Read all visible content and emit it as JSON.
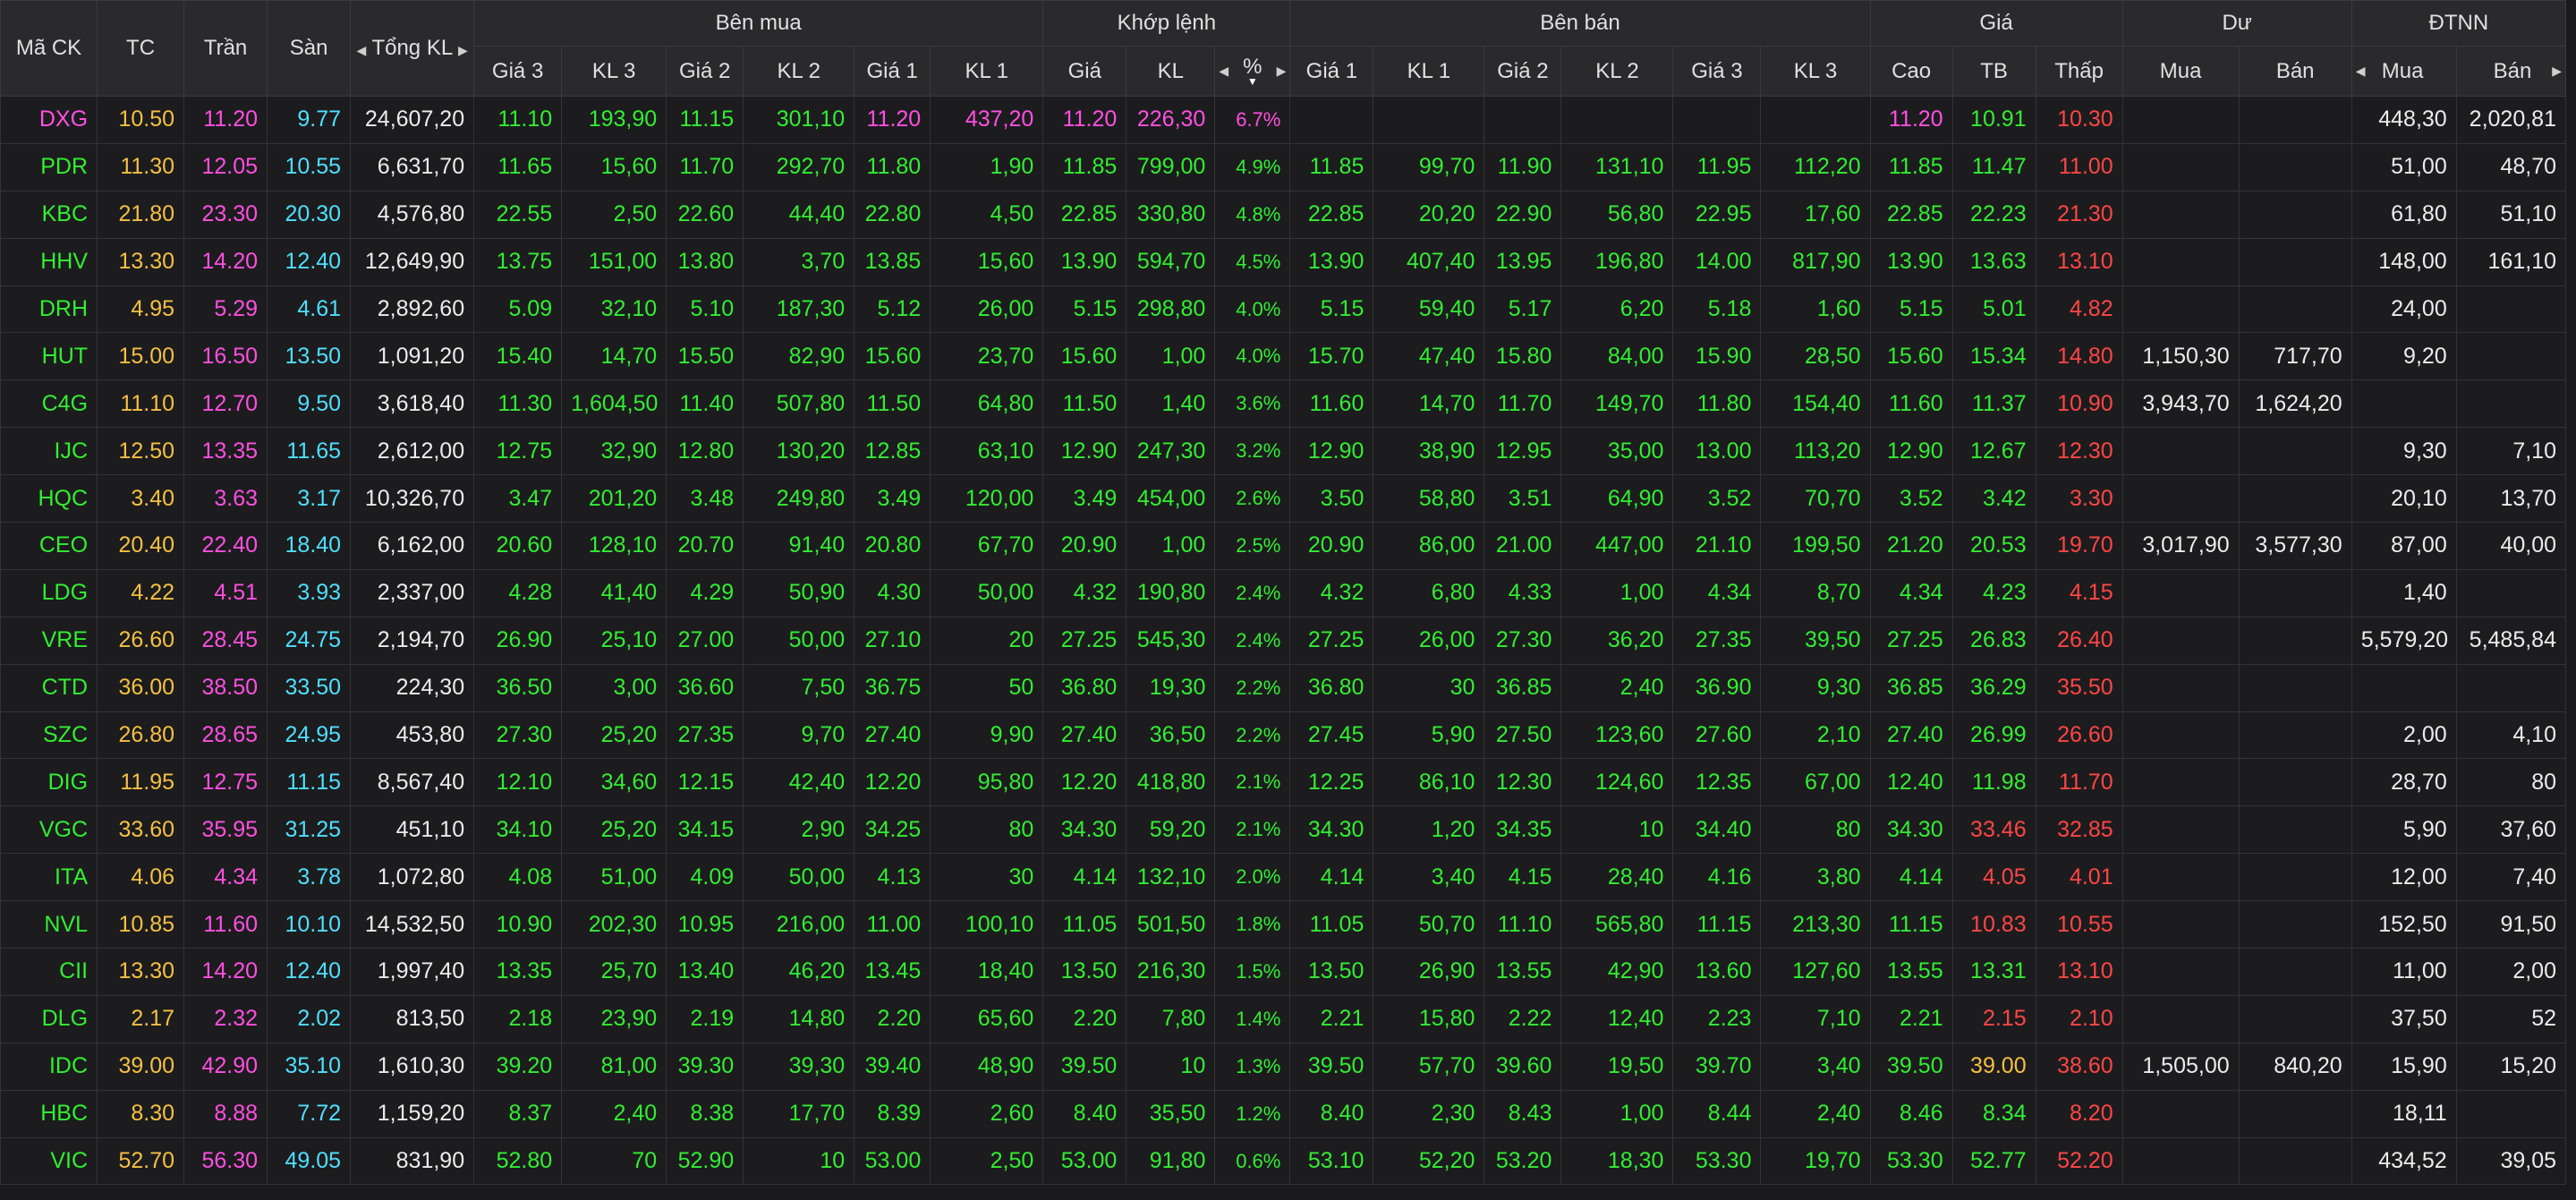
{
  "colors": {
    "ref": "#f5c042",
    "ceiling": "#ff4fe2",
    "floor": "#4fdfff",
    "up": "#32ee32",
    "down": "#ff4545",
    "neutral": "#ececec"
  },
  "header": {
    "symbol": "Mã CK",
    "ref": "TC",
    "ceiling": "Trần",
    "floor": "Sàn",
    "total_volume": "Tổng KL",
    "groups": {
      "buy": "Bên mua",
      "match": "Khớp lệnh",
      "sell": "Bên bán",
      "price": "Giá",
      "remaining": "Dư",
      "foreign": "ĐTNN"
    },
    "sub": {
      "buy": [
        "Giá 3",
        "KL 3",
        "Giá 2",
        "KL 2",
        "Giá 1",
        "KL 1"
      ],
      "match": [
        "Giá",
        "KL",
        "%"
      ],
      "sell": [
        "Giá 1",
        "KL 1",
        "Giá 2",
        "KL 2",
        "Giá 3",
        "KL 3"
      ],
      "price": [
        "Cao",
        "TB",
        "Thấp"
      ],
      "remaining": [
        "Mua",
        "Bán"
      ],
      "foreign": [
        "Mua",
        "Bán"
      ]
    }
  },
  "rows": [
    {
      "sym": "DXG",
      "tc": "10.50",
      "tran": "11.20",
      "san": "9.77",
      "tkl": "24,607,20",
      "bg3": "11.10",
      "bk3": "193,90",
      "bg2": "11.15",
      "bk2": "301,10",
      "bg1": "11.20",
      "bk1": "437,20",
      "mg": "11.20",
      "mk": "226,30",
      "mp": "6.7%",
      "sg1": "",
      "sk1": "",
      "sg2": "",
      "sk2": "",
      "sg3": "",
      "sk3": "",
      "cao": "11.20",
      "tb": "10.91",
      "thap": "10.30",
      "dm": "",
      "db": "",
      "fm": "448,30",
      "fb": "2,020,81"
    },
    {
      "sym": "PDR",
      "tc": "11.30",
      "tran": "12.05",
      "san": "10.55",
      "tkl": "6,631,70",
      "bg3": "11.65",
      "bk3": "15,60",
      "bg2": "11.70",
      "bk2": "292,70",
      "bg1": "11.80",
      "bk1": "1,90",
      "mg": "11.85",
      "mk": "799,00",
      "mp": "4.9%",
      "sg1": "11.85",
      "sk1": "99,70",
      "sg2": "11.90",
      "sk2": "131,10",
      "sg3": "11.95",
      "sk3": "112,20",
      "cao": "11.85",
      "tb": "11.47",
      "thap": "11.00",
      "dm": "",
      "db": "",
      "fm": "51,00",
      "fb": "48,70"
    },
    {
      "sym": "KBC",
      "tc": "21.80",
      "tran": "23.30",
      "san": "20.30",
      "tkl": "4,576,80",
      "bg3": "22.55",
      "bk3": "2,50",
      "bg2": "22.60",
      "bk2": "44,40",
      "bg1": "22.80",
      "bk1": "4,50",
      "mg": "22.85",
      "mk": "330,80",
      "mp": "4.8%",
      "sg1": "22.85",
      "sk1": "20,20",
      "sg2": "22.90",
      "sk2": "56,80",
      "sg3": "22.95",
      "sk3": "17,60",
      "cao": "22.85",
      "tb": "22.23",
      "thap": "21.30",
      "dm": "",
      "db": "",
      "fm": "61,80",
      "fb": "51,10"
    },
    {
      "sym": "HHV",
      "tc": "13.30",
      "tran": "14.20",
      "san": "12.40",
      "tkl": "12,649,90",
      "bg3": "13.75",
      "bk3": "151,00",
      "bg2": "13.80",
      "bk2": "3,70",
      "bg1": "13.85",
      "bk1": "15,60",
      "mg": "13.90",
      "mk": "594,70",
      "mp": "4.5%",
      "sg1": "13.90",
      "sk1": "407,40",
      "sg2": "13.95",
      "sk2": "196,80",
      "sg3": "14.00",
      "sk3": "817,90",
      "cao": "13.90",
      "tb": "13.63",
      "thap": "13.10",
      "dm": "",
      "db": "",
      "fm": "148,00",
      "fb": "161,10"
    },
    {
      "sym": "DRH",
      "tc": "4.95",
      "tran": "5.29",
      "san": "4.61",
      "tkl": "2,892,60",
      "bg3": "5.09",
      "bk3": "32,10",
      "bg2": "5.10",
      "bk2": "187,30",
      "bg1": "5.12",
      "bk1": "26,00",
      "mg": "5.15",
      "mk": "298,80",
      "mp": "4.0%",
      "sg1": "5.15",
      "sk1": "59,40",
      "sg2": "5.17",
      "sk2": "6,20",
      "sg3": "5.18",
      "sk3": "1,60",
      "cao": "5.15",
      "tb": "5.01",
      "thap": "4.82",
      "dm": "",
      "db": "",
      "fm": "24,00",
      "fb": ""
    },
    {
      "sym": "HUT",
      "tc": "15.00",
      "tran": "16.50",
      "san": "13.50",
      "tkl": "1,091,20",
      "bg3": "15.40",
      "bk3": "14,70",
      "bg2": "15.50",
      "bk2": "82,90",
      "bg1": "15.60",
      "bk1": "23,70",
      "mg": "15.60",
      "mk": "1,00",
      "mp": "4.0%",
      "sg1": "15.70",
      "sk1": "47,40",
      "sg2": "15.80",
      "sk2": "84,00",
      "sg3": "15.90",
      "sk3": "28,50",
      "cao": "15.60",
      "tb": "15.34",
      "thap": "14.80",
      "dm": "1,150,30",
      "db": "717,70",
      "fm": "9,20",
      "fb": ""
    },
    {
      "sym": "C4G",
      "tc": "11.10",
      "tran": "12.70",
      "san": "9.50",
      "tkl": "3,618,40",
      "bg3": "11.30",
      "bk3": "1,604,50",
      "bg2": "11.40",
      "bk2": "507,80",
      "bg1": "11.50",
      "bk1": "64,80",
      "mg": "11.50",
      "mk": "1,40",
      "mp": "3.6%",
      "sg1": "11.60",
      "sk1": "14,70",
      "sg2": "11.70",
      "sk2": "149,70",
      "sg3": "11.80",
      "sk3": "154,40",
      "cao": "11.60",
      "tb": "11.37",
      "thap": "10.90",
      "dm": "3,943,70",
      "db": "1,624,20",
      "fm": "",
      "fb": ""
    },
    {
      "sym": "IJC",
      "tc": "12.50",
      "tran": "13.35",
      "san": "11.65",
      "tkl": "2,612,00",
      "bg3": "12.75",
      "bk3": "32,90",
      "bg2": "12.80",
      "bk2": "130,20",
      "bg1": "12.85",
      "bk1": "63,10",
      "mg": "12.90",
      "mk": "247,30",
      "mp": "3.2%",
      "sg1": "12.90",
      "sk1": "38,90",
      "sg2": "12.95",
      "sk2": "35,00",
      "sg3": "13.00",
      "sk3": "113,20",
      "cao": "12.90",
      "tb": "12.67",
      "thap": "12.30",
      "dm": "",
      "db": "",
      "fm": "9,30",
      "fb": "7,10"
    },
    {
      "sym": "HQC",
      "tc": "3.40",
      "tran": "3.63",
      "san": "3.17",
      "tkl": "10,326,70",
      "bg3": "3.47",
      "bk3": "201,20",
      "bg2": "3.48",
      "bk2": "249,80",
      "bg1": "3.49",
      "bk1": "120,00",
      "mg": "3.49",
      "mk": "454,00",
      "mp": "2.6%",
      "sg1": "3.50",
      "sk1": "58,80",
      "sg2": "3.51",
      "sk2": "64,90",
      "sg3": "3.52",
      "sk3": "70,70",
      "cao": "3.52",
      "tb": "3.42",
      "thap": "3.30",
      "dm": "",
      "db": "",
      "fm": "20,10",
      "fb": "13,70"
    },
    {
      "sym": "CEO",
      "tc": "20.40",
      "tran": "22.40",
      "san": "18.40",
      "tkl": "6,162,00",
      "bg3": "20.60",
      "bk3": "128,10",
      "bg2": "20.70",
      "bk2": "91,40",
      "bg1": "20.80",
      "bk1": "67,70",
      "mg": "20.90",
      "mk": "1,00",
      "mp": "2.5%",
      "sg1": "20.90",
      "sk1": "86,00",
      "sg2": "21.00",
      "sk2": "447,00",
      "sg3": "21.10",
      "sk3": "199,50",
      "cao": "21.20",
      "tb": "20.53",
      "thap": "19.70",
      "dm": "3,017,90",
      "db": "3,577,30",
      "fm": "87,00",
      "fb": "40,00"
    },
    {
      "sym": "LDG",
      "tc": "4.22",
      "tran": "4.51",
      "san": "3.93",
      "tkl": "2,337,00",
      "bg3": "4.28",
      "bk3": "41,40",
      "bg2": "4.29",
      "bk2": "50,90",
      "bg1": "4.30",
      "bk1": "50,00",
      "mg": "4.32",
      "mk": "190,80",
      "mp": "2.4%",
      "sg1": "4.32",
      "sk1": "6,80",
      "sg2": "4.33",
      "sk2": "1,00",
      "sg3": "4.34",
      "sk3": "8,70",
      "cao": "4.34",
      "tb": "4.23",
      "thap": "4.15",
      "dm": "",
      "db": "",
      "fm": "1,40",
      "fb": ""
    },
    {
      "sym": "VRE",
      "tc": "26.60",
      "tran": "28.45",
      "san": "24.75",
      "tkl": "2,194,70",
      "bg3": "26.90",
      "bk3": "25,10",
      "bg2": "27.00",
      "bk2": "50,00",
      "bg1": "27.10",
      "bk1": "20",
      "mg": "27.25",
      "mk": "545,30",
      "mp": "2.4%",
      "sg1": "27.25",
      "sk1": "26,00",
      "sg2": "27.30",
      "sk2": "36,20",
      "sg3": "27.35",
      "sk3": "39,50",
      "cao": "27.25",
      "tb": "26.83",
      "thap": "26.40",
      "dm": "",
      "db": "",
      "fm": "5,579,20",
      "fb": "5,485,84"
    },
    {
      "sym": "CTD",
      "tc": "36.00",
      "tran": "38.50",
      "san": "33.50",
      "tkl": "224,30",
      "bg3": "36.50",
      "bk3": "3,00",
      "bg2": "36.60",
      "bk2": "7,50",
      "bg1": "36.75",
      "bk1": "50",
      "mg": "36.80",
      "mk": "19,30",
      "mp": "2.2%",
      "sg1": "36.80",
      "sk1": "30",
      "sg2": "36.85",
      "sk2": "2,40",
      "sg3": "36.90",
      "sk3": "9,30",
      "cao": "36.85",
      "tb": "36.29",
      "thap": "35.50",
      "dm": "",
      "db": "",
      "fm": "",
      "fb": ""
    },
    {
      "sym": "SZC",
      "tc": "26.80",
      "tran": "28.65",
      "san": "24.95",
      "tkl": "453,80",
      "bg3": "27.30",
      "bk3": "25,20",
      "bg2": "27.35",
      "bk2": "9,70",
      "bg1": "27.40",
      "bk1": "9,90",
      "mg": "27.40",
      "mk": "36,50",
      "mp": "2.2%",
      "sg1": "27.45",
      "sk1": "5,90",
      "sg2": "27.50",
      "sk2": "123,60",
      "sg3": "27.60",
      "sk3": "2,10",
      "cao": "27.40",
      "tb": "26.99",
      "thap": "26.60",
      "dm": "",
      "db": "",
      "fm": "2,00",
      "fb": "4,10"
    },
    {
      "sym": "DIG",
      "tc": "11.95",
      "tran": "12.75",
      "san": "11.15",
      "tkl": "8,567,40",
      "bg3": "12.10",
      "bk3": "34,60",
      "bg2": "12.15",
      "bk2": "42,40",
      "bg1": "12.20",
      "bk1": "95,80",
      "mg": "12.20",
      "mk": "418,80",
      "mp": "2.1%",
      "sg1": "12.25",
      "sk1": "86,10",
      "sg2": "12.30",
      "sk2": "124,60",
      "sg3": "12.35",
      "sk3": "67,00",
      "cao": "12.40",
      "tb": "11.98",
      "thap": "11.70",
      "dm": "",
      "db": "",
      "fm": "28,70",
      "fb": "80"
    },
    {
      "sym": "VGC",
      "tc": "33.60",
      "tran": "35.95",
      "san": "31.25",
      "tkl": "451,10",
      "bg3": "34.10",
      "bk3": "25,20",
      "bg2": "34.15",
      "bk2": "2,90",
      "bg1": "34.25",
      "bk1": "80",
      "mg": "34.30",
      "mk": "59,20",
      "mp": "2.1%",
      "sg1": "34.30",
      "sk1": "1,20",
      "sg2": "34.35",
      "sk2": "10",
      "sg3": "34.40",
      "sk3": "80",
      "cao": "34.30",
      "tb": "33.46",
      "thap": "32.85",
      "dm": "",
      "db": "",
      "fm": "5,90",
      "fb": "37,60"
    },
    {
      "sym": "ITA",
      "tc": "4.06",
      "tran": "4.34",
      "san": "3.78",
      "tkl": "1,072,80",
      "bg3": "4.08",
      "bk3": "51,00",
      "bg2": "4.09",
      "bk2": "50,00",
      "bg1": "4.13",
      "bk1": "30",
      "mg": "4.14",
      "mk": "132,10",
      "mp": "2.0%",
      "sg1": "4.14",
      "sk1": "3,40",
      "sg2": "4.15",
      "sk2": "28,40",
      "sg3": "4.16",
      "sk3": "3,80",
      "cao": "4.14",
      "tb": "4.05",
      "thap": "4.01",
      "dm": "",
      "db": "",
      "fm": "12,00",
      "fb": "7,40"
    },
    {
      "sym": "NVL",
      "tc": "10.85",
      "tran": "11.60",
      "san": "10.10",
      "tkl": "14,532,50",
      "bg3": "10.90",
      "bk3": "202,30",
      "bg2": "10.95",
      "bk2": "216,00",
      "bg1": "11.00",
      "bk1": "100,10",
      "mg": "11.05",
      "mk": "501,50",
      "mp": "1.8%",
      "sg1": "11.05",
      "sk1": "50,70",
      "sg2": "11.10",
      "sk2": "565,80",
      "sg3": "11.15",
      "sk3": "213,30",
      "cao": "11.15",
      "tb": "10.83",
      "thap": "10.55",
      "dm": "",
      "db": "",
      "fm": "152,50",
      "fb": "91,50"
    },
    {
      "sym": "CII",
      "tc": "13.30",
      "tran": "14.20",
      "san": "12.40",
      "tkl": "1,997,40",
      "bg3": "13.35",
      "bk3": "25,70",
      "bg2": "13.40",
      "bk2": "46,20",
      "bg1": "13.45",
      "bk1": "18,40",
      "mg": "13.50",
      "mk": "216,30",
      "mp": "1.5%",
      "sg1": "13.50",
      "sk1": "26,90",
      "sg2": "13.55",
      "sk2": "42,90",
      "sg3": "13.60",
      "sk3": "127,60",
      "cao": "13.55",
      "tb": "13.31",
      "thap": "13.10",
      "dm": "",
      "db": "",
      "fm": "11,00",
      "fb": "2,00"
    },
    {
      "sym": "DLG",
      "tc": "2.17",
      "tran": "2.32",
      "san": "2.02",
      "tkl": "813,50",
      "bg3": "2.18",
      "bk3": "23,90",
      "bg2": "2.19",
      "bk2": "14,80",
      "bg1": "2.20",
      "bk1": "65,60",
      "mg": "2.20",
      "mk": "7,80",
      "mp": "1.4%",
      "sg1": "2.21",
      "sk1": "15,80",
      "sg2": "2.22",
      "sk2": "12,40",
      "sg3": "2.23",
      "sk3": "7,10",
      "cao": "2.21",
      "tb": "2.15",
      "thap": "2.10",
      "dm": "",
      "db": "",
      "fm": "37,50",
      "fb": "52"
    },
    {
      "sym": "IDC",
      "tc": "39.00",
      "tran": "42.90",
      "san": "35.10",
      "tkl": "1,610,30",
      "bg3": "39.20",
      "bk3": "81,00",
      "bg2": "39.30",
      "bk2": "39,30",
      "bg1": "39.40",
      "bk1": "48,90",
      "mg": "39.50",
      "mk": "10",
      "mp": "1.3%",
      "sg1": "39.50",
      "sk1": "57,70",
      "sg2": "39.60",
      "sk2": "19,50",
      "sg3": "39.70",
      "sk3": "3,40",
      "cao": "39.50",
      "tb": "39.00",
      "thap": "38.60",
      "dm": "1,505,00",
      "db": "840,20",
      "fm": "15,90",
      "fb": "15,20"
    },
    {
      "sym": "HBC",
      "tc": "8.30",
      "tran": "8.88",
      "san": "7.72",
      "tkl": "1,159,20",
      "bg3": "8.37",
      "bk3": "2,40",
      "bg2": "8.38",
      "bk2": "17,70",
      "bg1": "8.39",
      "bk1": "2,60",
      "mg": "8.40",
      "mk": "35,50",
      "mp": "1.2%",
      "sg1": "8.40",
      "sk1": "2,30",
      "sg2": "8.43",
      "sk2": "1,00",
      "sg3": "8.44",
      "sk3": "2,40",
      "cao": "8.46",
      "tb": "8.34",
      "thap": "8.20",
      "dm": "",
      "db": "",
      "fm": "18,11",
      "fb": ""
    },
    {
      "sym": "VIC",
      "tc": "52.70",
      "tran": "56.30",
      "san": "49.05",
      "tkl": "831,90",
      "bg3": "52.80",
      "bk3": "70",
      "bg2": "52.90",
      "bk2": "10",
      "bg1": "53.00",
      "bk1": "2,50",
      "mg": "53.00",
      "mk": "91,80",
      "mp": "0.6%",
      "sg1": "53.10",
      "sk1": "52,20",
      "sg2": "53.20",
      "sk2": "18,30",
      "sg3": "53.30",
      "sk3": "19,70",
      "cao": "53.30",
      "tb": "52.77",
      "thap": "52.20",
      "dm": "",
      "db": "",
      "fm": "434,52",
      "fb": "39,05"
    }
  ]
}
